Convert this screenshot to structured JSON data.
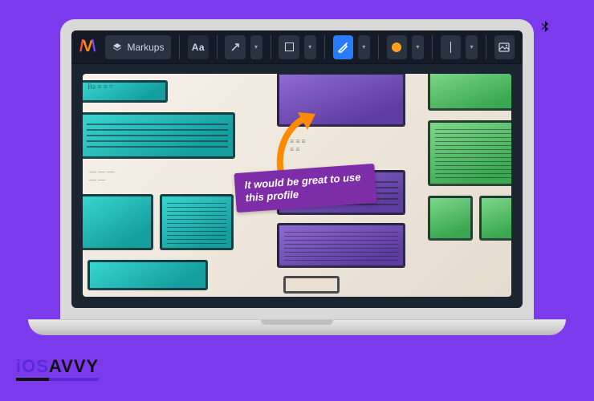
{
  "status_icons": {
    "bluetooth": "bluetooth"
  },
  "toolbar": {
    "markups_label": "Markups",
    "text_tool_label": "Aa",
    "colors": {
      "stroke_selected": "#2a7cff",
      "fill_dot": "#ff9f1a"
    }
  },
  "annotation": {
    "note_text": "It would be great to use this profile"
  },
  "brand": {
    "part1": "iOS",
    "part2": "AVVY"
  }
}
